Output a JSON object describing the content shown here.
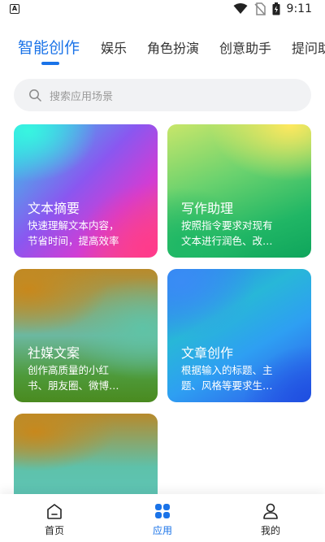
{
  "status_bar": {
    "time": "9:11",
    "app_badge": "A"
  },
  "tabs": [
    {
      "label": "智能创作",
      "active": true
    },
    {
      "label": "娱乐"
    },
    {
      "label": "角色扮演"
    },
    {
      "label": "创意助手"
    },
    {
      "label": "提问助"
    }
  ],
  "search": {
    "placeholder": "搜索应用场景"
  },
  "cards": [
    {
      "title": "文本摘要",
      "desc_line1": "快速理解文本内容，",
      "desc_line2": "节省时间，提高效率"
    },
    {
      "title": "写作助理",
      "desc_line1": "按照指令要求对现有",
      "desc_line2": "文本进行润色、改…"
    },
    {
      "title": "社媒文案",
      "desc_line1": "创作高质量的小红",
      "desc_line2": "书、朋友圈、微博…"
    },
    {
      "title": "文章创作",
      "desc_line1": "根据输入的标题、主",
      "desc_line2": "题、风格等要求生…"
    }
  ],
  "bottom_nav": [
    {
      "label": "首页",
      "icon": "home-icon"
    },
    {
      "label": "应用",
      "icon": "apps-icon",
      "active": true
    },
    {
      "label": "我的",
      "icon": "profile-icon"
    }
  ],
  "colors": {
    "accent": "#1a73e8"
  }
}
